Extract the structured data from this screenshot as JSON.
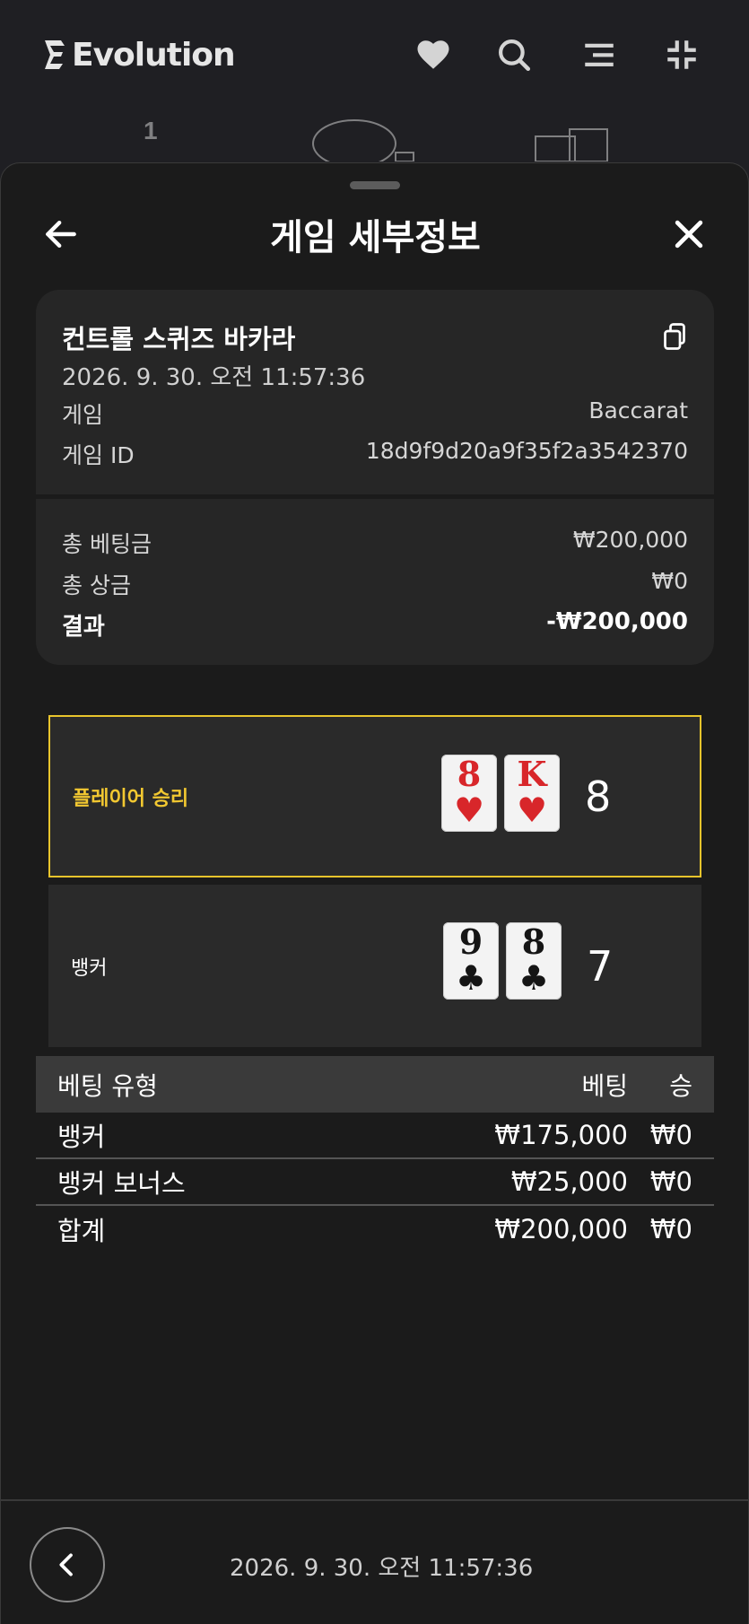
{
  "brand": {
    "name": "Evolution"
  },
  "top_icons": [
    "heart-icon",
    "search-icon",
    "menu-icon",
    "collapse-icon"
  ],
  "background": {
    "peek_number": "1"
  },
  "sheet": {
    "title": "게임 세부정보",
    "info": {
      "game_name": "컨트롤 스퀴즈 바카라",
      "datetime": "2026. 9. 30. 오전 11:57:36",
      "rows": [
        {
          "label": "게임",
          "value": "Baccarat"
        },
        {
          "label": "게임 ID",
          "value": "18d9f9d20a9f35f2a3542370"
        }
      ],
      "totals": [
        {
          "label": "총 베팅금",
          "value": "₩200,000"
        },
        {
          "label": "총 상금",
          "value": "₩0"
        },
        {
          "label": "결과",
          "value": "-₩200,000"
        }
      ]
    },
    "results": {
      "player": {
        "label": "플레이어 승리",
        "cards": [
          {
            "rank": "8",
            "suit": "♥",
            "color": "#d8262a"
          },
          {
            "rank": "K",
            "suit": "♥",
            "color": "#d8262a"
          }
        ],
        "score": "8",
        "highlight_color": "#e8c42c"
      },
      "banker": {
        "label": "뱅커",
        "cards": [
          {
            "rank": "9",
            "suit": "♣",
            "color": "#151515"
          },
          {
            "rank": "8",
            "suit": "♣",
            "color": "#151515"
          }
        ],
        "score": "7"
      }
    },
    "bets": {
      "headers": {
        "type": "베팅 유형",
        "bet": "베팅",
        "win": "승"
      },
      "rows": [
        {
          "type": "뱅커",
          "bet": "₩175,000",
          "win": "₩0"
        },
        {
          "type": "뱅커 보너스",
          "bet": "₩25,000",
          "win": "₩0"
        }
      ],
      "total": {
        "type": "합계",
        "bet": "₩200,000",
        "win": "₩0"
      }
    },
    "footer": {
      "datetime": "2026. 9. 30. 오전 11:57:36"
    }
  }
}
